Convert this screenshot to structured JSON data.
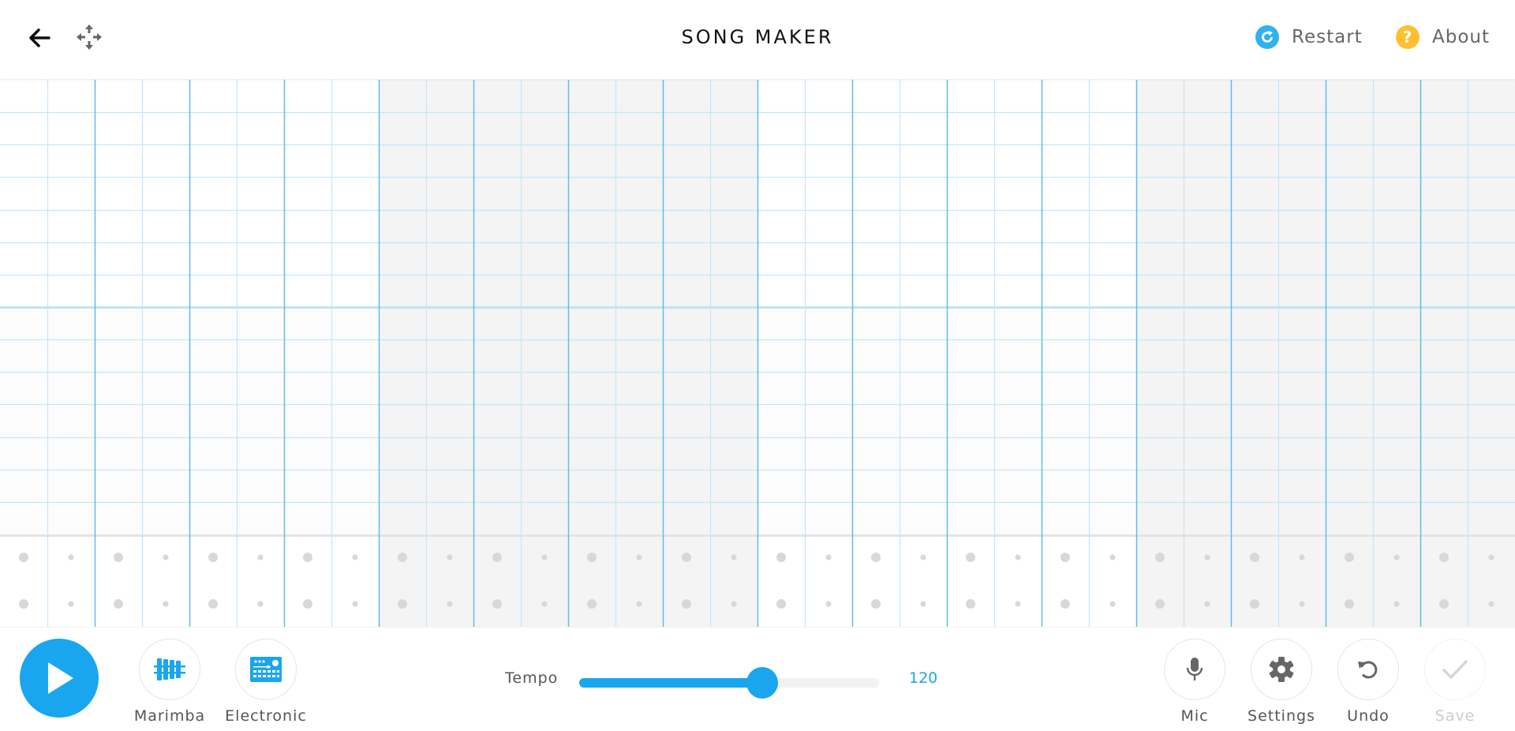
{
  "header": {
    "title": "SONG MAKER",
    "back_icon": "arrow-left-icon",
    "move_icon": "move-arrows-icon",
    "restart_label": "Restart",
    "restart_icon": "refresh-icon",
    "about_label": "About",
    "about_icon": "question-icon"
  },
  "colors": {
    "accent": "#1aa6ef",
    "about_yellow": "#ffbf2f",
    "grid_line": "#c6e6f8",
    "grid_bar_line": "#5bbdf2",
    "shaded_bar_bg": "#f4f4f4",
    "drum_dot": "#d8d8d8"
  },
  "grid": {
    "bars": 4,
    "beats_per_bar": 4,
    "subdivisions_per_beat": 2,
    "melody_rows": 14,
    "octave_divider_after_row": 7,
    "percussion_rows": 2,
    "shaded_bars": [
      2,
      4
    ],
    "notes": []
  },
  "bottom": {
    "play_icon": "play-icon",
    "instruments": [
      {
        "label": "Marimba",
        "icon": "marimba-icon"
      },
      {
        "label": "Electronic",
        "icon": "drum-machine-icon"
      }
    ],
    "tempo_label": "Tempo",
    "tempo_value": "120",
    "tempo_fraction": 0.61,
    "actions": [
      {
        "label": "Mic",
        "icon": "mic-icon",
        "enabled": true
      },
      {
        "label": "Settings",
        "icon": "gear-icon",
        "enabled": true
      },
      {
        "label": "Undo",
        "icon": "undo-icon",
        "enabled": true
      },
      {
        "label": "Save",
        "icon": "check-icon",
        "enabled": false
      }
    ]
  }
}
